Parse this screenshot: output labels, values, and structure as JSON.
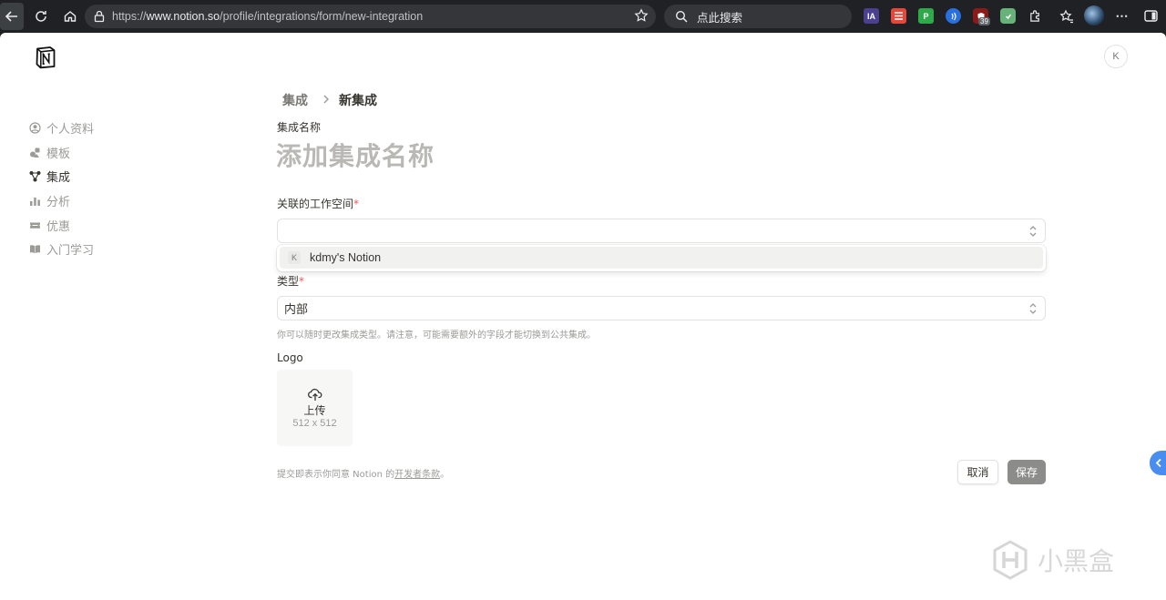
{
  "browser": {
    "url_prefix": "https://",
    "url_host": "www.notion.so",
    "url_path": "/profile/integrations/form/new-integration",
    "search_placeholder": "点此搜索",
    "ext_ia": "IA",
    "ext_badge_count": "39"
  },
  "header": {
    "avatar_letter": "K"
  },
  "sidebar": {
    "items": [
      {
        "label": "个人资料",
        "icon": "person-circle-icon"
      },
      {
        "label": "模板",
        "icon": "shapes-icon"
      },
      {
        "label": "集成",
        "icon": "nodes-icon"
      },
      {
        "label": "分析",
        "icon": "chart-icon"
      },
      {
        "label": "优惠",
        "icon": "ticket-icon"
      },
      {
        "label": "入门学习",
        "icon": "book-icon"
      }
    ],
    "active_index": 2
  },
  "breadcrumb": {
    "parent": "集成",
    "current": "新集成"
  },
  "form": {
    "name_label": "集成名称",
    "name_placeholder": "添加集成名称",
    "workspace_label": "关联的工作空间",
    "workspace_value": "",
    "workspace_options": [
      {
        "badge": "K",
        "label": "kdmy's Notion"
      }
    ],
    "type_label": "类型",
    "type_value": "内部",
    "type_hint": "你可以随时更改集成类型。请注意，可能需要额外的字段才能切换到公共集成。",
    "logo_label": "Logo",
    "upload_label": "上传",
    "upload_size": "512 x 512",
    "required_mark": "*",
    "terms_prefix": "提交即表示你同意 Notion 的",
    "terms_link": "开发者条款",
    "terms_suffix": "。",
    "cancel_label": "取消",
    "save_label": "保存"
  },
  "watermark": {
    "text": "小黑盒"
  },
  "colors": {
    "accent_blue": "#4a8df0",
    "required_red": "#eb5757",
    "save_bg": "#8c8c8a"
  }
}
